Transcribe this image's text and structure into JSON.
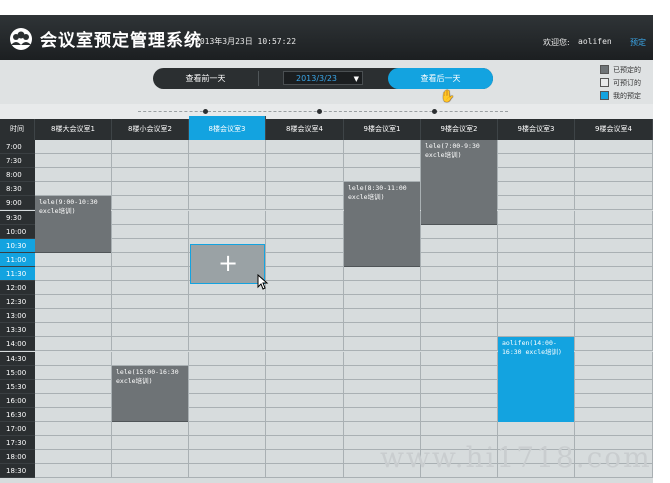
{
  "header": {
    "title": "会议室预定管理系统",
    "datetime": "2013年3月23日 10:57:22",
    "welcome": "欢迎您:",
    "username": "aolifen",
    "nav_link": "预定"
  },
  "toolbar": {
    "prev_label": "查看前一天",
    "date_value": "2013/3/23",
    "next_label": "查看后一天"
  },
  "legend": [
    {
      "label": "已预定的",
      "color": "#6e7376"
    },
    {
      "label": "可预订的",
      "color": "#e8eaeb"
    },
    {
      "label": "我的预定",
      "color": "#13a3e0"
    }
  ],
  "grid": {
    "time_header": "时间",
    "rooms": [
      "8楼大会议室1",
      "8楼小会议室2",
      "8楼会议室3",
      "8楼会议室4",
      "9楼会议室1",
      "9楼会议室2",
      "9楼会议室3",
      "9楼会议室4"
    ],
    "active_room_index": 2,
    "times": [
      "7:00",
      "7:30",
      "8:00",
      "8:30",
      "9:00",
      "9:30",
      "10:00",
      "10:30",
      "11:00",
      "11:30",
      "12:00",
      "12:30",
      "13:00",
      "13:30",
      "14:00",
      "14:30",
      "15:00",
      "15:30",
      "16:00",
      "16:30",
      "17:00",
      "17:30",
      "18:00",
      "18:30"
    ],
    "highlight_times": [
      7,
      8,
      9
    ],
    "bookings": [
      {
        "text": "lele(9:00-10:30 excle培训)",
        "col": 0,
        "start": 4,
        "span": 4,
        "mine": false
      },
      {
        "text": "lele(15:00-16:30 excle培训)",
        "col": 1,
        "start": 16,
        "span": 4,
        "mine": false
      },
      {
        "text": "lele(8:30-11:00 excle培训)",
        "col": 4,
        "start": 3,
        "span": 6,
        "mine": false
      },
      {
        "text": "lele(7:00-9:30 excle培训)",
        "col": 5,
        "start": 0,
        "span": 6,
        "mine": false
      },
      {
        "text": "aolifen(14:00-16:30 excle培训)",
        "col": 6,
        "start": 14,
        "span": 6,
        "mine": true
      }
    ]
  },
  "colors": {
    "accent": "#13a3e0",
    "dark": "#2b2f31",
    "booked": "#6e7376"
  },
  "watermark": "www.hi1718.com"
}
